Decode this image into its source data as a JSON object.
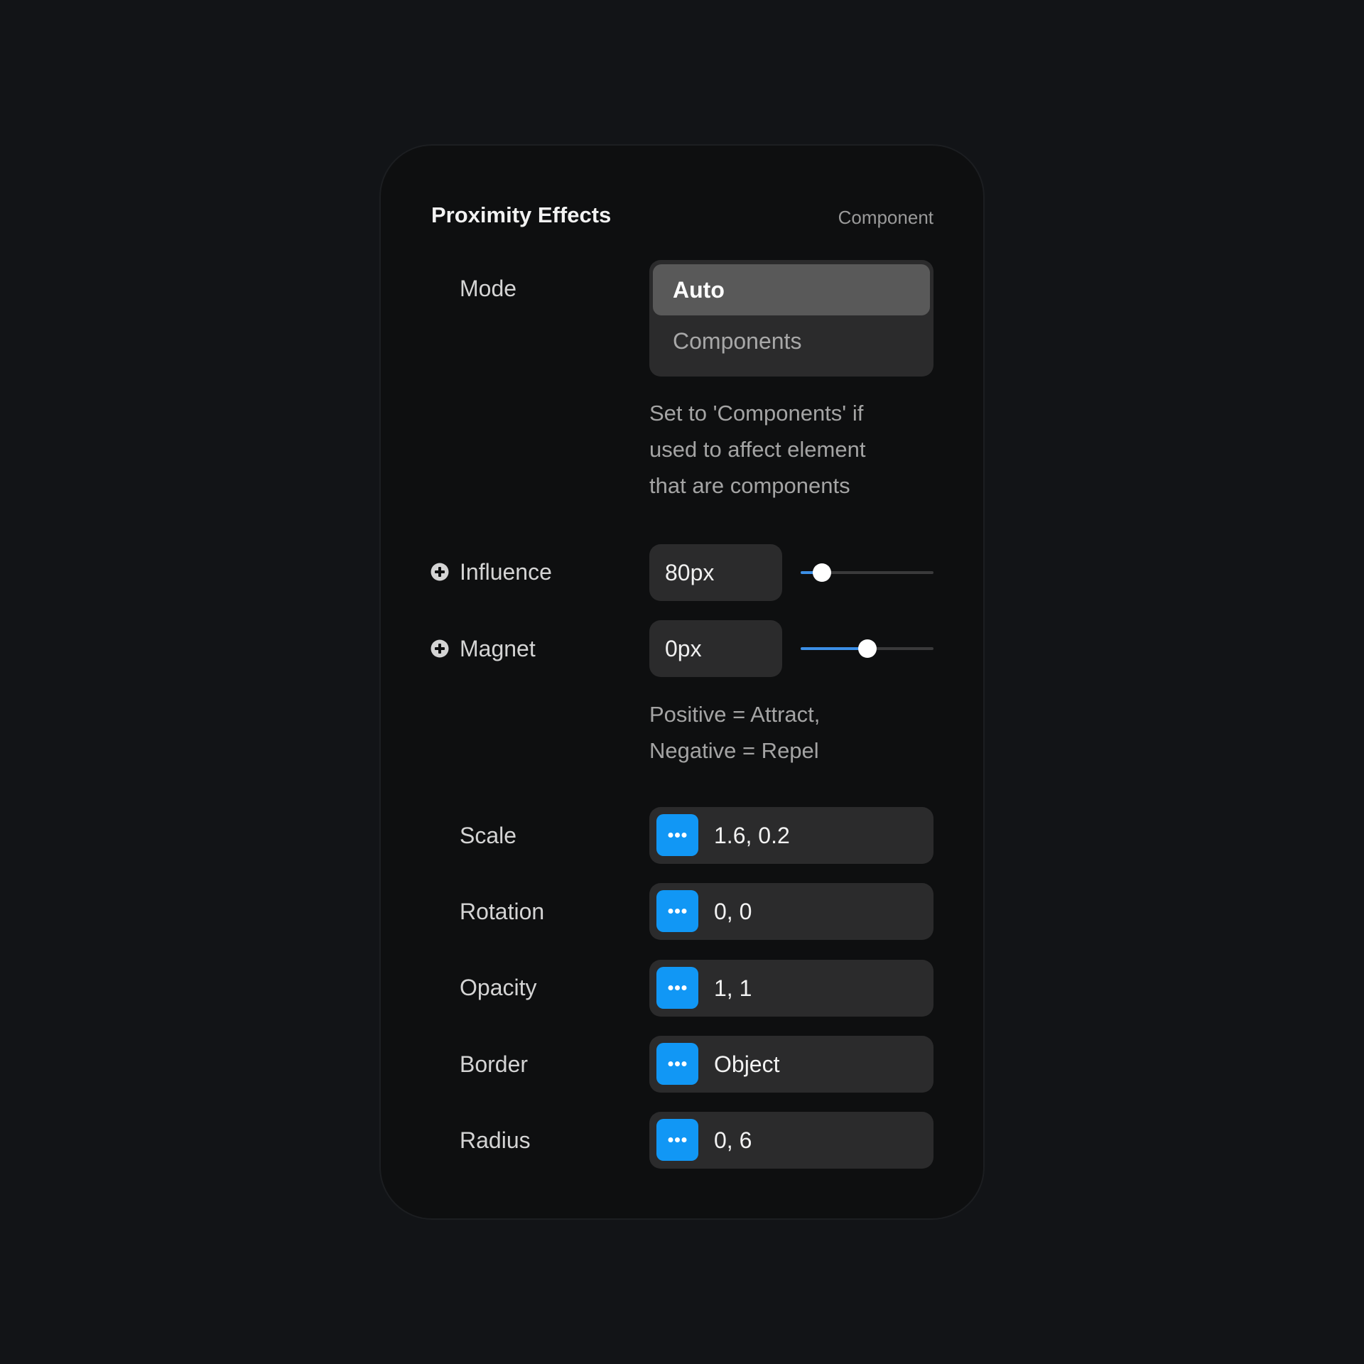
{
  "panel": {
    "title": "Proximity Effects",
    "subtitle": "Component"
  },
  "mode": {
    "label": "Mode",
    "options": [
      "Auto",
      "Components"
    ],
    "selected": "Auto",
    "description_lines": [
      "Set to 'Components' if",
      "used to affect element",
      "that are components"
    ]
  },
  "influence": {
    "label": "Influence",
    "value": "80px",
    "slider_fraction": 0.16
  },
  "magnet": {
    "label": "Magnet",
    "value": "0px",
    "slider_fraction": 0.5,
    "description_lines": [
      "Positive = Attract,",
      "Negative = Repel"
    ]
  },
  "properties": [
    {
      "label": "Scale",
      "value": "1.6, 0.2"
    },
    {
      "label": "Rotation",
      "value": "0, 0"
    },
    {
      "label": "Opacity",
      "value": "1, 1"
    },
    {
      "label": "Border",
      "value": "Object"
    },
    {
      "label": "Radius",
      "value": "0, 6"
    }
  ],
  "colors": {
    "accent": "#1197f5",
    "slider_fill": "#3c8fe6",
    "panel_bg": "#0e0f10",
    "field_bg": "#2b2b2c"
  }
}
